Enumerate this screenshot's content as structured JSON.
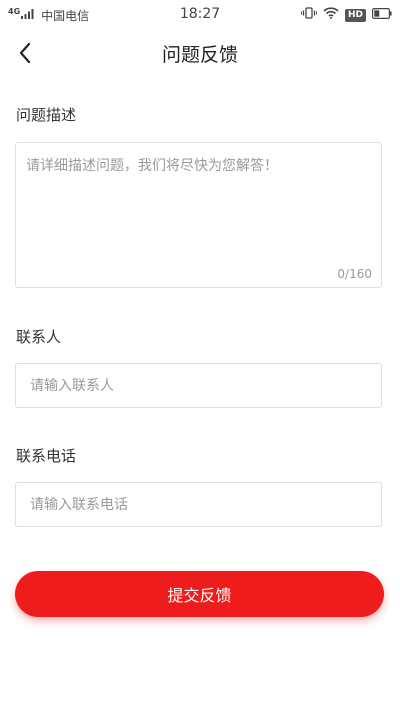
{
  "status_bar": {
    "signal_label": "4G",
    "carrier": "中国电信",
    "time": "18:27",
    "hd_badge": "HD",
    "icons": [
      "signal-icon",
      "vibrate-icon",
      "wifi-icon",
      "hd-icon",
      "battery-icon"
    ]
  },
  "header": {
    "title": "问题反馈",
    "back_icon": "chevron-left-icon"
  },
  "form": {
    "description": {
      "label": "问题描述",
      "placeholder": "请详细描述问题，我们将尽快为您解答！",
      "value": "",
      "counter": "0/160"
    },
    "contact": {
      "label": "联系人",
      "placeholder": "请输入联系人",
      "value": ""
    },
    "phone": {
      "label": "联系电话",
      "placeholder": "请输入联系电话",
      "value": ""
    },
    "submit_label": "提交反馈"
  },
  "colors": {
    "accent": "#ee1c1c",
    "border": "#dedede",
    "placeholder": "#9a9a9a"
  }
}
